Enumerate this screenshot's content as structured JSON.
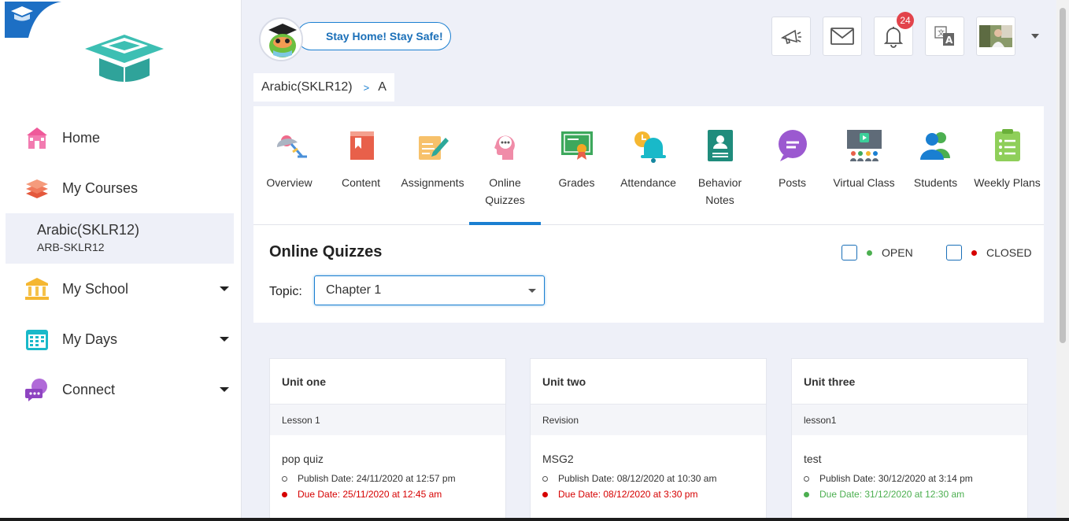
{
  "sidebar": {
    "items": [
      {
        "label": "Home",
        "icon": "school-building-icon"
      },
      {
        "label": "My Courses",
        "icon": "books-stack-icon"
      },
      {
        "label": "My School",
        "icon": "institution-icon"
      },
      {
        "label": "My Days",
        "icon": "calendar-icon"
      },
      {
        "label": "Connect",
        "icon": "chat-bubble-icon"
      }
    ],
    "current_course": {
      "name": "Arabic(SKLR12)",
      "code": "ARB-SKLR12"
    }
  },
  "header": {
    "promo_text": "Stay Home! Stay Safe!",
    "notification_count": "24",
    "icons": [
      "megaphone-icon",
      "mail-icon",
      "bell-icon",
      "translate-icon",
      "user-avatar"
    ]
  },
  "breadcrumb": {
    "course": "Arabic(SKLR12)",
    "separator": ">",
    "section": "A"
  },
  "tabs": [
    {
      "label": "Overview",
      "icon": "lamp-icon"
    },
    {
      "label": "Content",
      "icon": "book-icon"
    },
    {
      "label": "Assignments",
      "icon": "pencil-paper-icon"
    },
    {
      "label": "Online Quizzes",
      "icon": "head-thought-icon",
      "active": true
    },
    {
      "label": "Grades",
      "icon": "certificate-icon"
    },
    {
      "label": "Attendance",
      "icon": "alarm-bell-icon"
    },
    {
      "label": "Behavior Notes",
      "icon": "id-card-icon"
    },
    {
      "label": "Posts",
      "icon": "speech-bubble-icon"
    },
    {
      "label": "Virtual Class",
      "icon": "presentation-board-icon"
    },
    {
      "label": "Students",
      "icon": "people-icon"
    },
    {
      "label": "Weekly Plans",
      "icon": "clipboard-list-icon"
    }
  ],
  "quizzes": {
    "title": "Online Quizzes",
    "legend_open": "OPEN",
    "legend_closed": "CLOSED",
    "topic_label": "Topic:",
    "topic_value": "Chapter 1",
    "cards": [
      {
        "unit": "Unit one",
        "lesson": "Lesson 1",
        "quiz": "pop quiz",
        "publish": "Publish Date: 24/11/2020 at 12:57 pm",
        "due": "Due Date: 25/11/2020 at 12:45 am",
        "status": "closed"
      },
      {
        "unit": "Unit two",
        "lesson": "Revision",
        "quiz": "MSG2",
        "publish": "Publish Date: 08/12/2020 at 10:30 am",
        "due": "Due Date: 08/12/2020 at 3:30 pm",
        "status": "closed"
      },
      {
        "unit": "Unit three",
        "lesson": "lesson1",
        "quiz": "test",
        "publish": "Publish Date: 30/12/2020 at 3:14 pm",
        "due": "Due Date: 31/12/2020 at 12:30 am",
        "status": "open"
      }
    ]
  },
  "colors": {
    "accent": "#1a7fd1",
    "open": "#4caf50",
    "closed": "#d60000",
    "badge": "#e2434b"
  }
}
